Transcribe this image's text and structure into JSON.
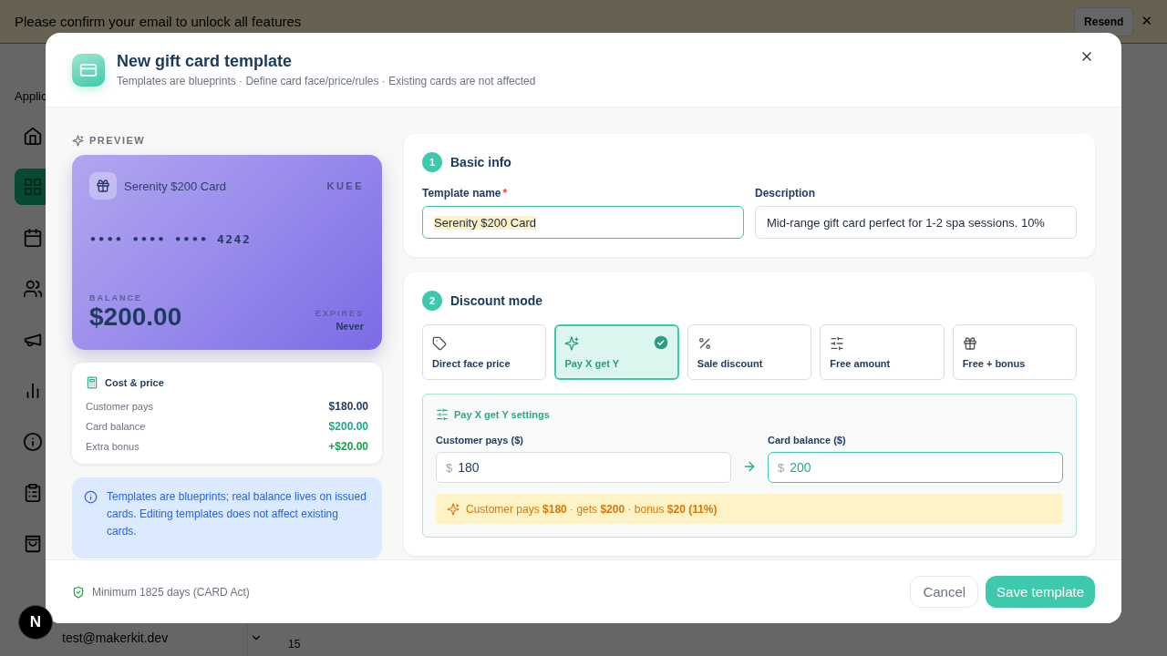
{
  "background": {
    "banner": {
      "text": "Please confirm your email to unlock all features",
      "button": "Resend",
      "close": "✕"
    },
    "sidebar": {
      "section_label": "Applic",
      "items": [
        {
          "selected": false
        },
        {
          "selected": true
        },
        {
          "selected": false
        },
        {
          "selected": false
        },
        {
          "selected": false
        },
        {
          "selected": false
        },
        {
          "selected": false
        },
        {
          "selected": false
        },
        {
          "selected": false
        }
      ],
      "user_email": "test@makerkit.dev"
    },
    "chart_tick": "15",
    "dev_badge": "N"
  },
  "dialog": {
    "title": "New gift card template",
    "subtitle": "Templates are blueprints · Define card face/price/rules · Existing cards are not affected",
    "preview": {
      "label": "PREVIEW",
      "card": {
        "name": "Serenity $200 Card",
        "brand": "KUEE",
        "number": "•••• •••• •••• 4242",
        "balance_label": "BALANCE",
        "balance": "$200.00",
        "expires_label": "EXPIRES",
        "expires": "Never"
      }
    },
    "cost": {
      "title": "Cost & price",
      "rows": [
        {
          "label": "Customer pays",
          "value": "$180.00",
          "kind": "plain"
        },
        {
          "label": "Card balance",
          "value": "$200.00",
          "kind": "balance"
        },
        {
          "label": "Extra bonus",
          "value": "+$20.00",
          "kind": "bonus"
        }
      ]
    },
    "info_note": "Templates are blueprints; real balance lives on issued cards. Editing templates does not affect existing cards.",
    "basic_info": {
      "step": "1",
      "title": "Basic info",
      "fields": [
        {
          "label": "Template name",
          "required_mark": "*",
          "value": "Serenity $200 Card",
          "focused": true
        },
        {
          "label": "Description",
          "value": "Mid-range gift card perfect for 1-2 spa sessions. 10%",
          "focused": false
        }
      ]
    },
    "discount_mode": {
      "step": "2",
      "title": "Discount mode",
      "modes": [
        {
          "label": "Direct face price",
          "selected": false
        },
        {
          "label": "Pay X get Y",
          "selected": true
        },
        {
          "label": "Sale discount",
          "selected": false
        },
        {
          "label": "Free amount",
          "selected": false
        },
        {
          "label": "Free + bonus",
          "selected": false
        }
      ],
      "settings": {
        "title": "Pay X get Y settings",
        "fields": [
          {
            "label": "Customer pays ($)",
            "prefix": "$",
            "value": "180",
            "focused": false
          },
          {
            "label": "Card balance ($)",
            "prefix": "$",
            "value": "200",
            "focused": true
          }
        ],
        "summary": "Customer pays **$180** · gets **$200** · bonus **$20 (11%)**"
      }
    },
    "footer": {
      "note": "Minimum 1825 days (CARD Act)",
      "buttons": [
        {
          "label": "Cancel",
          "kind": "secondary"
        },
        {
          "label": "Save template",
          "kind": "primary"
        }
      ]
    }
  }
}
